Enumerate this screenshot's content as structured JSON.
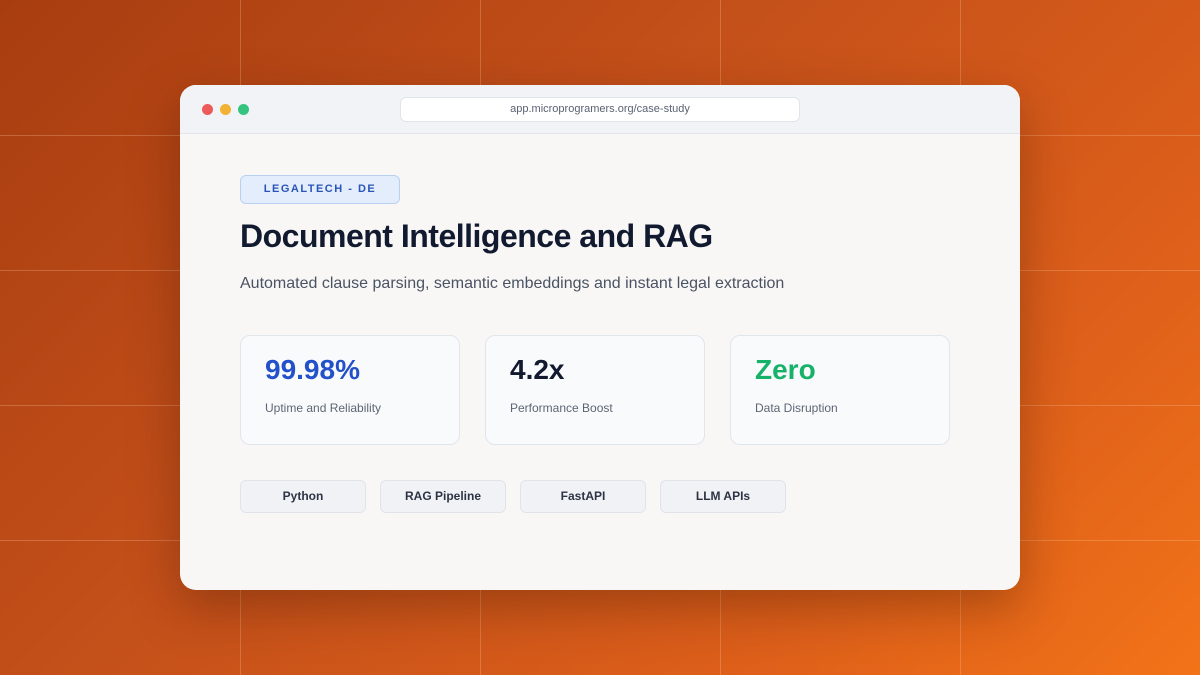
{
  "browser": {
    "url": "app.microprogramers.org/case-study"
  },
  "case_study": {
    "badge": "LEGALTECH - DE",
    "title": "Document Intelligence and RAG",
    "subtitle": "Automated clause parsing, semantic embeddings and instant legal extraction"
  },
  "stats": [
    {
      "value": "99.98%",
      "label": "Uptime and Reliability",
      "color": "#2251c9"
    },
    {
      "value": "4.2x",
      "label": "Performance Boost",
      "color": "#111a2e"
    },
    {
      "value": "Zero",
      "label": "Data Disruption",
      "color": "#17b26a"
    }
  ],
  "tech_tags": [
    "Python",
    "RAG Pipeline",
    "FastAPI",
    "LLM APIs"
  ],
  "colors": {
    "background_start": "#a83d10",
    "background_end": "#f27318",
    "badge_text": "#2a55b8",
    "title": "#111a2e"
  }
}
